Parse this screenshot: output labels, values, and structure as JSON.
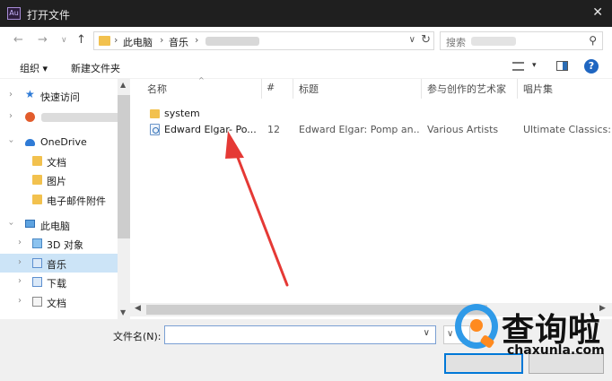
{
  "window": {
    "app_icon": "Au",
    "title": "打开文件",
    "close_glyph": "✕"
  },
  "address_bar": {
    "path": [
      "此电脑",
      "音乐"
    ],
    "search_placeholder": "搜索"
  },
  "toolbar": {
    "organize": "组织 ▾",
    "new_folder": "新建文件夹",
    "help": "?"
  },
  "nav_pane": {
    "items": [
      {
        "label": "快速访问",
        "icon": "star-icon"
      },
      {
        "label": "",
        "icon": "user-folder-icon"
      },
      {
        "label": "OneDrive",
        "icon": "cloud-icon"
      },
      {
        "label": "文档",
        "icon": "folder-icon"
      },
      {
        "label": "图片",
        "icon": "folder-icon"
      },
      {
        "label": "电子邮件附件",
        "icon": "folder-icon"
      },
      {
        "label": "此电脑",
        "icon": "computer-icon"
      },
      {
        "label": "3D 对象",
        "icon": "3d-objects-icon"
      },
      {
        "label": "音乐",
        "icon": "music-folder-icon",
        "selected": true
      },
      {
        "label": "下载",
        "icon": "downloads-icon"
      },
      {
        "label": "文档",
        "icon": "documents-icon"
      }
    ]
  },
  "file_list": {
    "columns": [
      "名称",
      "#",
      "标题",
      "参与创作的艺术家",
      "唱片集"
    ],
    "rows": [
      {
        "name": "system",
        "type": "folder",
        "number": "",
        "title": "",
        "artists": "",
        "album": ""
      },
      {
        "name": "Edward Elgar- Po...",
        "type": "audio",
        "number": "12",
        "title": "Edward Elgar: Pomp an...",
        "artists": "Various Artists",
        "album": "Ultimate Classics: T"
      }
    ]
  },
  "footer": {
    "filename_label": "文件名(N):",
    "filename_value": ""
  },
  "watermark": {
    "cn": "查询啦",
    "en": "chaxunla.com"
  },
  "colors": {
    "accent": "#0078d7",
    "selection": "#cce4f7",
    "arrow": "#e53935"
  }
}
